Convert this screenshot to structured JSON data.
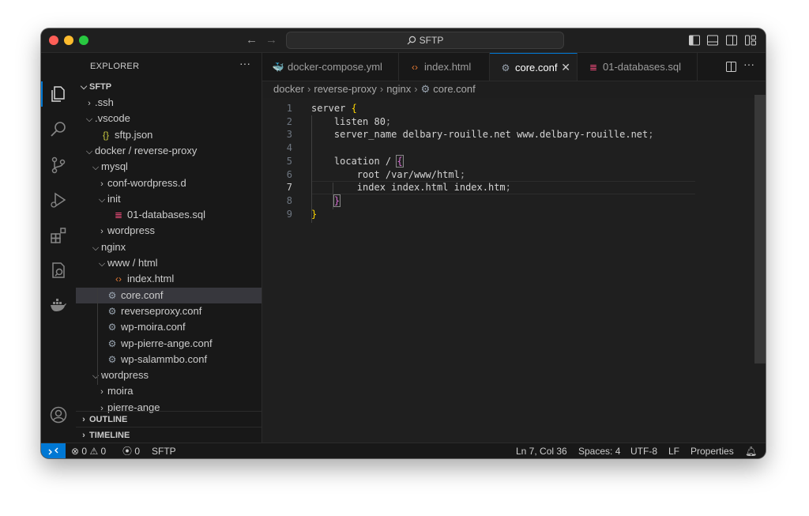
{
  "window": {
    "search_label": "SFTP"
  },
  "explorer": {
    "title": "EXPLORER",
    "more": "···",
    "root": "SFTP",
    "items": [
      {
        "label": ".ssh",
        "kind": "folder",
        "open": false,
        "depth": 1
      },
      {
        "label": ".vscode",
        "kind": "folder",
        "open": true,
        "depth": 1
      },
      {
        "label": "sftp.json",
        "kind": "json",
        "depth": 2
      },
      {
        "label": "docker / reverse-proxy",
        "kind": "folder",
        "open": true,
        "depth": 1
      },
      {
        "label": "mysql",
        "kind": "folder",
        "open": true,
        "depth": 2
      },
      {
        "label": "conf-wordpress.d",
        "kind": "folder",
        "open": false,
        "depth": 3
      },
      {
        "label": "init",
        "kind": "folder",
        "open": true,
        "depth": 3
      },
      {
        "label": "01-databases.sql",
        "kind": "sql",
        "depth": 4
      },
      {
        "label": "wordpress",
        "kind": "folder",
        "open": false,
        "depth": 3
      },
      {
        "label": "nginx",
        "kind": "folder",
        "open": true,
        "depth": 2
      },
      {
        "label": "www / html",
        "kind": "folder",
        "open": true,
        "depth": 3
      },
      {
        "label": "index.html",
        "kind": "html",
        "depth": 4
      },
      {
        "label": "core.conf",
        "kind": "conf",
        "depth": 3,
        "selected": true
      },
      {
        "label": "reverseproxy.conf",
        "kind": "conf",
        "depth": 3
      },
      {
        "label": "wp-moira.conf",
        "kind": "conf",
        "depth": 3
      },
      {
        "label": "wp-pierre-ange.conf",
        "kind": "conf",
        "depth": 3
      },
      {
        "label": "wp-salammbo.conf",
        "kind": "conf",
        "depth": 3
      },
      {
        "label": "wordpress",
        "kind": "folder",
        "open": true,
        "depth": 2
      },
      {
        "label": "moira",
        "kind": "folder",
        "open": false,
        "depth": 3
      },
      {
        "label": "pierre-ange",
        "kind": "folder",
        "open": false,
        "depth": 3
      }
    ],
    "panels": [
      "OUTLINE",
      "TIMELINE"
    ]
  },
  "tabs": [
    {
      "label": "docker-compose.yml",
      "icon": "docker-icon",
      "active": false
    },
    {
      "label": "index.html",
      "icon": "html-icon",
      "active": false
    },
    {
      "label": "core.conf",
      "icon": "gear-icon",
      "active": true,
      "close": "✕"
    },
    {
      "label": "01-databases.sql",
      "icon": "database-icon",
      "active": false
    }
  ],
  "breadcrumb": [
    "docker",
    "reverse-proxy",
    "nginx",
    "core.conf"
  ],
  "editor": {
    "current_line": 7,
    "lines": [
      {
        "n": "1",
        "tokens": [
          [
            "server ",
            "t"
          ],
          [
            "{",
            "b1"
          ]
        ]
      },
      {
        "n": "2",
        "tokens": [
          [
            "    listen 80",
            "t"
          ],
          [
            ";",
            "p"
          ]
        ]
      },
      {
        "n": "3",
        "tokens": [
          [
            "    server_name delbary-rouille.net www.delbary-rouille.net",
            "t"
          ],
          [
            ";",
            "p"
          ]
        ]
      },
      {
        "n": "4",
        "tokens": []
      },
      {
        "n": "5",
        "tokens": [
          [
            "    location / ",
            "t"
          ],
          [
            "{",
            "b2m"
          ]
        ]
      },
      {
        "n": "6",
        "tokens": [
          [
            "        root /var/www/html",
            "t"
          ],
          [
            ";",
            "p"
          ]
        ]
      },
      {
        "n": "7",
        "tokens": [
          [
            "        index index.html index.htm",
            "t"
          ],
          [
            ";",
            "p"
          ]
        ]
      },
      {
        "n": "8",
        "tokens": [
          [
            "    ",
            "t"
          ],
          [
            "}",
            "b2m"
          ]
        ]
      },
      {
        "n": "9",
        "tokens": [
          [
            "}",
            "b1"
          ]
        ]
      }
    ]
  },
  "status": {
    "errors": "0",
    "warnings": "0",
    "ports": "0",
    "remote_name": "SFTP",
    "position": "Ln 7, Col 36",
    "spaces": "Spaces: 4",
    "encoding": "UTF-8",
    "eol": "LF",
    "language": "Properties"
  },
  "colors": {
    "accent": "#0078d4",
    "bracket_gold": "#ffd700",
    "bracket_purple": "#da70d6",
    "json_icon": "#cbcb41",
    "sql_icon": "#f14c7c",
    "html_icon": "#e37933",
    "docker_icon": "#e0537a"
  }
}
